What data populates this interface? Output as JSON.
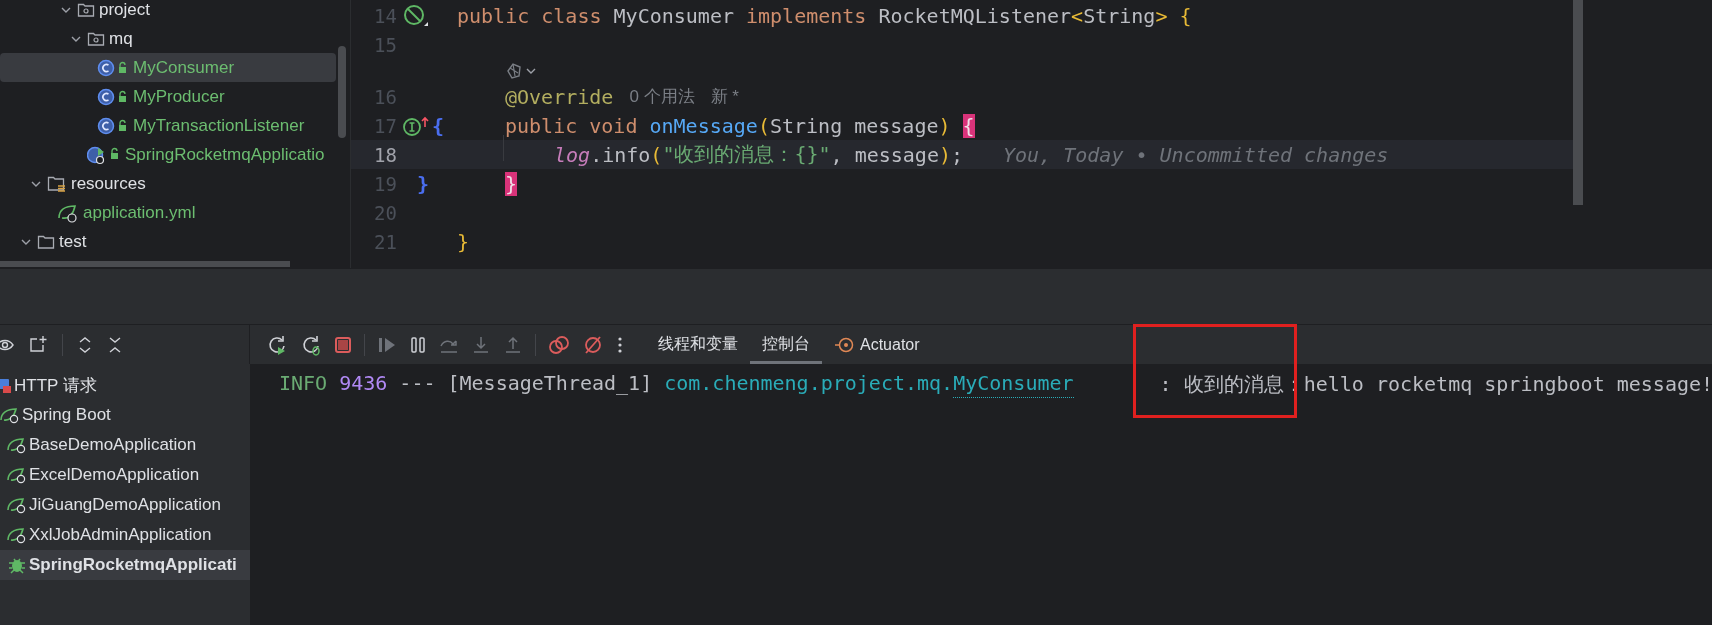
{
  "project_tree": {
    "items": [
      {
        "label": "project",
        "kind": "package",
        "vcs_new": false,
        "selected": false,
        "expanded": true,
        "children": [
          {
            "label": "mq",
            "kind": "package",
            "vcs_new": false,
            "selected": false,
            "expanded": true,
            "children": [
              {
                "label": "MyConsumer",
                "kind": "class",
                "vcs_new": true,
                "selected": true
              },
              {
                "label": "MyProducer",
                "kind": "class",
                "vcs_new": true,
                "selected": false
              },
              {
                "label": "MyTransactionListener",
                "kind": "class",
                "vcs_new": true,
                "selected": false
              }
            ]
          },
          {
            "label": "SpringRocketmqApplicatio",
            "kind": "spring-app",
            "vcs_new": true,
            "selected": false
          }
        ]
      },
      {
        "label": "resources",
        "kind": "resource-folder",
        "vcs_new": false,
        "selected": false,
        "expanded": true,
        "children": [
          {
            "label": "application.yml",
            "kind": "config",
            "vcs_new": true,
            "selected": false
          }
        ]
      },
      {
        "label": "test",
        "kind": "folder",
        "vcs_new": false,
        "selected": false,
        "expanded": true
      }
    ]
  },
  "editor": {
    "lines": [
      {
        "kind": "code",
        "number": "14",
        "current": false,
        "in_class": false,
        "gutter_icon": {
          "kind": "bean"
        },
        "tokens": [
          {
            "text": "public class ",
            "kind": "keyword"
          },
          {
            "text": "MyConsumer ",
            "kind": "plain"
          },
          {
            "text": "implements ",
            "kind": "keyword"
          },
          {
            "text": "RocketMQListener",
            "kind": "plain"
          },
          {
            "text": "<",
            "kind": "bracket"
          },
          {
            "text": "String",
            "kind": "plain"
          },
          {
            "text": ">",
            "kind": "bracket"
          },
          {
            "text": " {",
            "kind": "bracket"
          }
        ]
      },
      {
        "kind": "code",
        "number": "15",
        "current": false
      },
      {
        "kind": "inlay"
      },
      {
        "kind": "code",
        "number": "16",
        "current": false,
        "in_class": true,
        "in_method": false,
        "tokens": [
          {
            "text": "@Override",
            "kind": "annotation"
          },
          {
            "text": "0 个用法",
            "kind": "hint"
          },
          {
            "text": "新 *",
            "kind": "hint"
          }
        ]
      },
      {
        "kind": "code",
        "number": "17",
        "current": false,
        "in_class": true,
        "in_method": false,
        "gutter_icon": {
          "kind": "implements"
        },
        "fold": "{",
        "tokens": [
          {
            "text": "public void ",
            "kind": "keyword"
          },
          {
            "text": "onMessage",
            "kind": "method"
          },
          {
            "text": "(",
            "kind": "bracket"
          },
          {
            "text": "String message",
            "kind": "plain"
          },
          {
            "text": ") ",
            "kind": "bracket"
          },
          {
            "text": "{",
            "kind": "match"
          }
        ]
      },
      {
        "kind": "code",
        "number": "18",
        "current": true,
        "in_class": true,
        "in_method": true,
        "tokens": [
          {
            "text": "log",
            "kind": "field"
          },
          {
            "text": ".info",
            "kind": "plain"
          },
          {
            "text": "(",
            "kind": "bracket"
          },
          {
            "text": "\"收到的消息：{}\"",
            "kind": "string"
          },
          {
            "text": ", message",
            "kind": "plain"
          },
          {
            "text": ")",
            "kind": "bracket"
          },
          {
            "text": ";",
            "kind": "plain"
          }
        ],
        "blame": "You, Today • Uncommitted changes"
      },
      {
        "kind": "code",
        "number": "19",
        "current": false,
        "in_class": true,
        "in_method": false,
        "fold": "}",
        "tokens": [
          {
            "text": "}",
            "kind": "match"
          }
        ]
      },
      {
        "kind": "code",
        "number": "20",
        "current": false
      },
      {
        "kind": "code",
        "number": "21",
        "current": false,
        "in_class": false,
        "tokens": [
          {
            "text": "}",
            "kind": "bracket"
          }
        ]
      }
    ]
  },
  "services": {
    "items": [
      {
        "label": "HTTP 请求",
        "kind": "http",
        "selected": false
      },
      {
        "label": "Spring Boot",
        "kind": "spring-boot",
        "selected": false,
        "children": [
          {
            "label": "BaseDemoApplication",
            "kind": "app",
            "selected": false
          },
          {
            "label": "ExcelDemoApplication",
            "kind": "app",
            "selected": false
          },
          {
            "label": "JiGuangDemoApplication",
            "kind": "app",
            "selected": false
          },
          {
            "label": "XxlJobAdminApplication",
            "kind": "app",
            "selected": false
          },
          {
            "label": "SpringRocketmqApplicati",
            "kind": "debug-app",
            "selected": true
          }
        ]
      }
    ]
  },
  "debugger": {
    "tabs": [
      {
        "label": "线程和变量",
        "selected": false
      },
      {
        "label": "控制台",
        "selected": true
      },
      {
        "label": "Actuator",
        "kind": "actuator",
        "selected": false
      }
    ],
    "console": {
      "lines": [
        {
          "segments": [
            {
              "text": "INFO",
              "kind": "level"
            },
            {
              "text": "9436",
              "kind": "pid"
            },
            {
              "text": "---",
              "kind": "separator"
            },
            {
              "text": "[MessageThread_1]",
              "kind": "thread"
            },
            {
              "text": "com.chenmeng.project.mq.",
              "kind": "logger"
            },
            {
              "text": "MyConsumer",
              "kind": "link"
            },
            {
              "text": ": 收到的消息：hello rocketmq springboot message!",
              "kind": "message"
            }
          ]
        }
      ]
    }
  }
}
